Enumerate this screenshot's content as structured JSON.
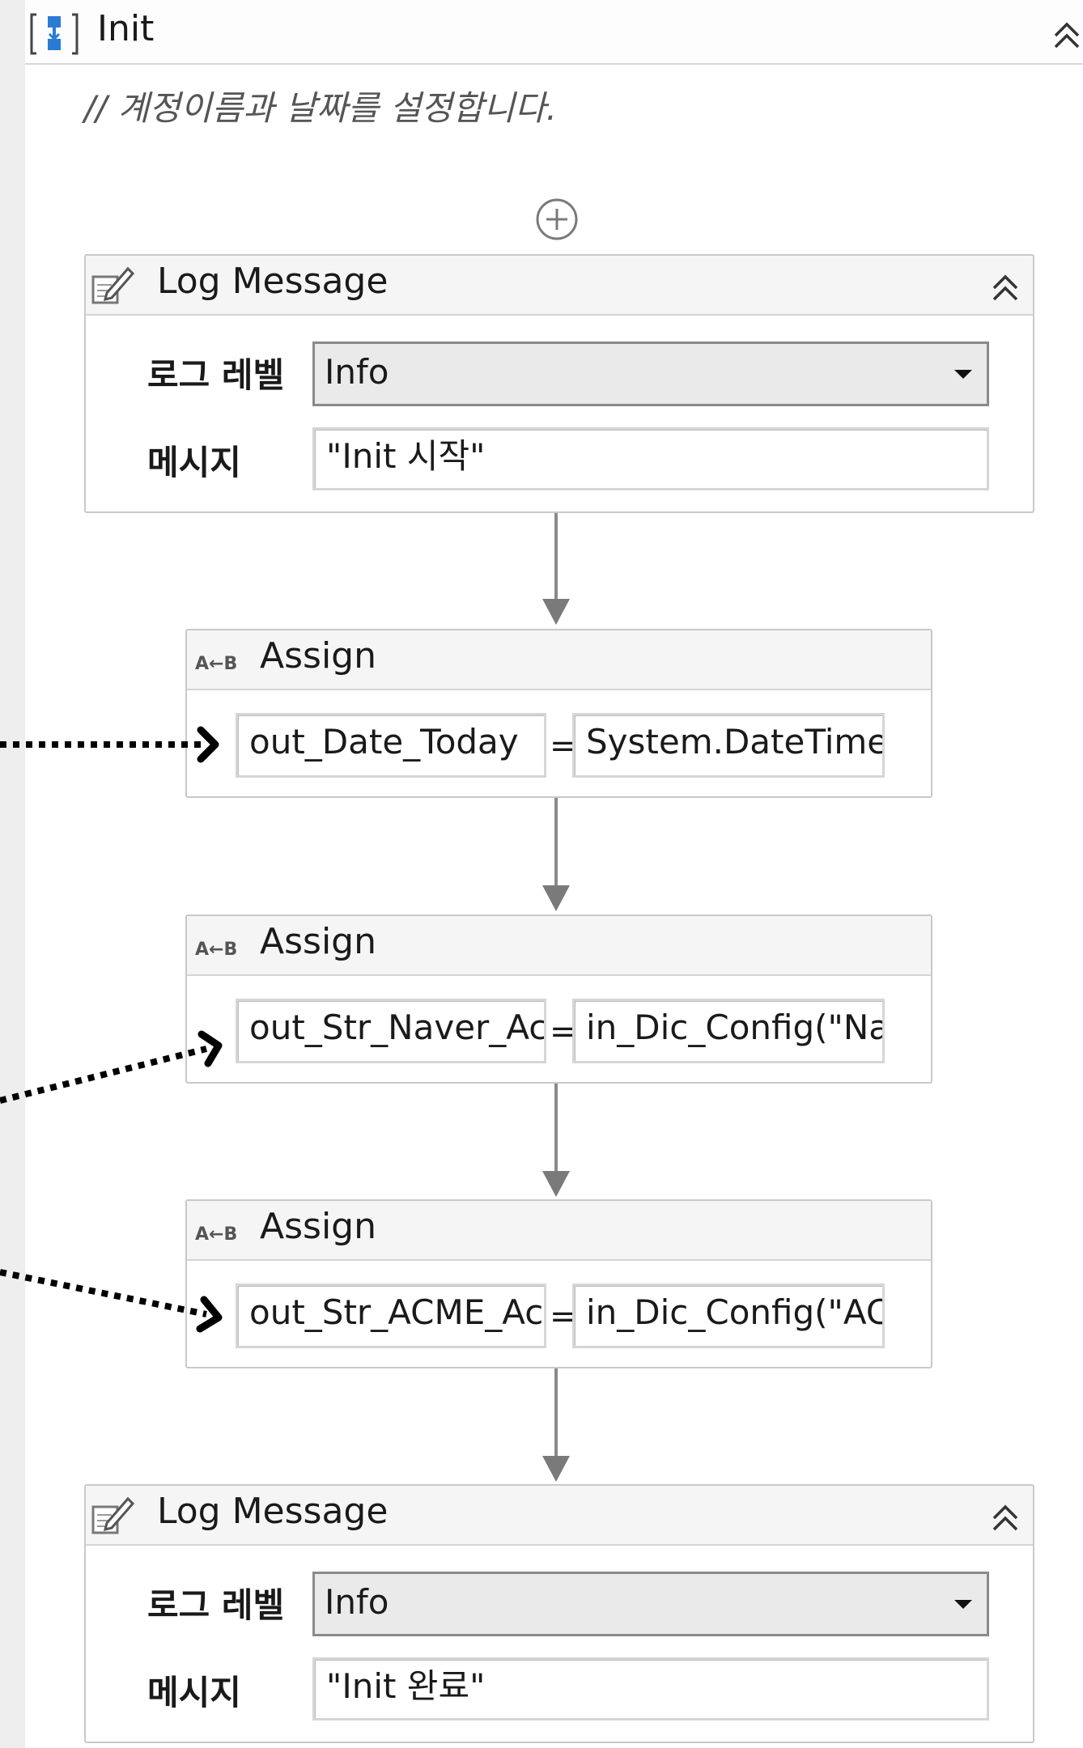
{
  "sequence": {
    "title": "Init",
    "comment": "// 계정이름과 날짜를 설정합니다."
  },
  "log1": {
    "title": "Log Message",
    "level_label": "로그 레벨",
    "level_value": "Info",
    "message_label": "메시지",
    "message_value": "\"Init 시작\""
  },
  "assign1": {
    "title": "Assign",
    "to": "out_Date_Today",
    "eq": "=",
    "value": "System.DateTime.I"
  },
  "assign2": {
    "title": "Assign",
    "to": "out_Str_Naver_Acc",
    "eq": "=",
    "value": "in_Dic_Config(\"Na"
  },
  "assign3": {
    "title": "Assign",
    "to": "out_Str_ACME_Acc",
    "eq": "=",
    "value": "in_Dic_Config(\"AC"
  },
  "log2": {
    "title": "Log Message",
    "level_label": "로그 레벨",
    "level_value": "Info",
    "message_label": "메시지",
    "message_value": "\"Init 완료\""
  },
  "icons": {
    "sequence": "sequence-icon",
    "collapse": "double-chevron-up-icon",
    "add": "add-circle-icon",
    "log": "log-message-icon",
    "assign": "assign-icon"
  }
}
